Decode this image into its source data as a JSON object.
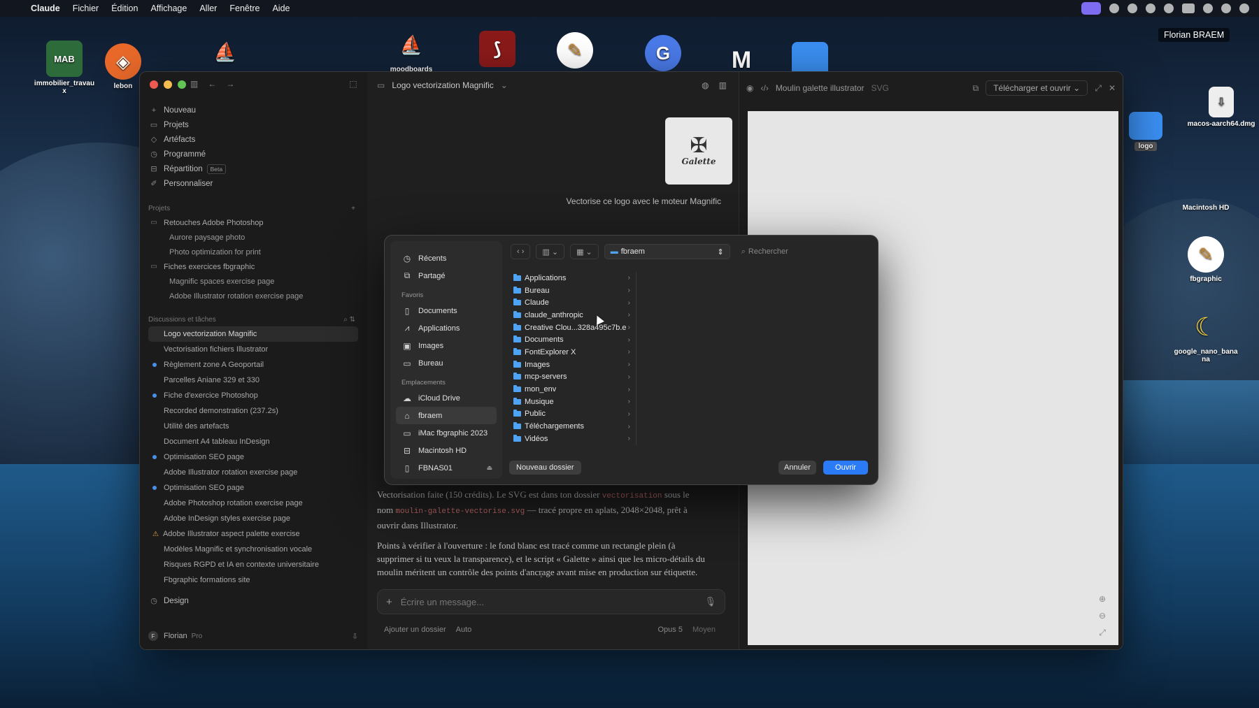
{
  "menubar": {
    "app": "Claude",
    "items": [
      "Fichier",
      "Édition",
      "Affichage",
      "Aller",
      "Fenêtre",
      "Aide"
    ]
  },
  "user_name": "Florian BRAEM",
  "desktop_icons": {
    "immobilier": "immobilier_travau\nx",
    "leboncoin": "lebon",
    "moodboards": "moodboards",
    "logo_folder": "logo",
    "dmg": "macos-aarch64.dmg",
    "macintosh": "Macintosh HD",
    "fbgraphic": "fbgraphic",
    "banana": "google_nano_bana na"
  },
  "sidebar": {
    "nav": [
      {
        "icon": "plus-icon",
        "label": "Nouveau"
      },
      {
        "icon": "folder-icon",
        "label": "Projets"
      },
      {
        "icon": "artifact-icon",
        "label": "Artéfacts"
      },
      {
        "icon": "clock-icon",
        "label": "Programmé"
      },
      {
        "icon": "split-icon",
        "label": "Répartition",
        "badge": "Beta"
      },
      {
        "icon": "brush-icon",
        "label": "Personnaliser"
      }
    ],
    "projects_title": "Projets",
    "projects": [
      {
        "label": "Retouches Adobe Photoshop",
        "level": 0
      },
      {
        "label": "Aurore paysage photo",
        "level": 1
      },
      {
        "label": "Photo optimization for print",
        "level": 1
      },
      {
        "label": "Fiches exercices fbgraphic",
        "level": 0
      },
      {
        "label": "Magnific spaces exercise page",
        "level": 1
      },
      {
        "label": "Adobe Illustrator rotation exercise page",
        "level": 1
      }
    ],
    "chats_title": "Discussions et tâches",
    "chats": [
      {
        "label": "Logo vectorization Magnific",
        "marker": "none",
        "active": true
      },
      {
        "label": "Vectorisation fichiers Illustrator",
        "marker": "none"
      },
      {
        "label": "Règlement zone A Geoportail",
        "marker": "blue"
      },
      {
        "label": "Parcelles Aniane 329 et 330",
        "marker": "none"
      },
      {
        "label": "Fiche d'exercice Photoshop",
        "marker": "blue"
      },
      {
        "label": "Recorded demonstration (237.2s)",
        "marker": "none"
      },
      {
        "label": "Utilité des artefacts",
        "marker": "none"
      },
      {
        "label": "Document A4 tableau InDesign",
        "marker": "none"
      },
      {
        "label": "Optimisation SEO page",
        "marker": "blue"
      },
      {
        "label": "Adobe Illustrator rotation exercise page",
        "marker": "none"
      },
      {
        "label": "Optimisation SEO page",
        "marker": "blue"
      },
      {
        "label": "Adobe Photoshop rotation exercise page",
        "marker": "none"
      },
      {
        "label": "Adobe InDesign styles exercise page",
        "marker": "none"
      },
      {
        "label": "Adobe Illustrator aspect palette exercise",
        "marker": "warn"
      },
      {
        "label": "Modèles Magnific et synchronisation vocale",
        "marker": "none"
      },
      {
        "label": "Risques RGPD et IA en contexte universitaire",
        "marker": "none"
      },
      {
        "label": "Fbgraphic formations site",
        "marker": "none"
      }
    ],
    "design": "Design",
    "footer": {
      "initial": "F",
      "name": "Florian",
      "plan": "Pro"
    }
  },
  "chat": {
    "title": "Logo vectorization Magnific",
    "thumb_text": "Galette",
    "user_message": "Vectorise ce logo avec le moteur Magnific",
    "p1_a": "Vectorisation faite (150 crédits). Le SVG est dans ton dossier ",
    "p1_code1": "vectorisation",
    "p1_b": " sous le nom ",
    "p1_code2": "moulin-galette-vectorise.svg",
    "p1_c": " — tracé propre en aplats, 2048×2048, prêt à ouvrir dans Illustrator.",
    "p2": "Points à vérifier à l'ouverture : le fond blanc est tracé comme un rectangle plein (à supprimer si tu veux la transparence), et le script « Galette » ainsi que les micro-détails du moulin méritent un contrôle des points d'ancrage avant mise en production sur étiquette.",
    "composer_placeholder": "Écrire un message...",
    "add_folder": "Ajouter un dossier",
    "auto": "Auto",
    "model": "Opus 5",
    "mode": "Moyen"
  },
  "artifact": {
    "title": "Moulin galette illustrator",
    "type": "SVG",
    "download": "Télécharger et ouvrir"
  },
  "dialog": {
    "sidebar_top": [
      {
        "icon": "clock-icon",
        "label": "Récents"
      },
      {
        "icon": "shared-icon",
        "label": "Partagé"
      }
    ],
    "favorites_title": "Favoris",
    "favorites": [
      {
        "icon": "document-icon",
        "label": "Documents"
      },
      {
        "icon": "applications-icon",
        "label": "Applications"
      },
      {
        "icon": "images-icon",
        "label": "Images"
      },
      {
        "icon": "desktop-icon",
        "label": "Bureau"
      }
    ],
    "locations_title": "Emplacements",
    "locations": [
      {
        "icon": "cloud-icon",
        "label": "iCloud Drive"
      },
      {
        "icon": "home-icon",
        "label": "fbraem",
        "active": true
      },
      {
        "icon": "computer-icon",
        "label": "iMac fbgraphic 2023"
      },
      {
        "icon": "disk-icon",
        "label": "Macintosh HD"
      },
      {
        "icon": "nas-icon",
        "label": "FBNAS01",
        "eject": true
      }
    ],
    "path": "fbraem",
    "search_placeholder": "Rechercher",
    "folders": [
      "Applications",
      "Bureau",
      "Claude",
      "claude_anthropic",
      "Creative Clou...328a495c7b.e",
      "Documents",
      "FontExplorer X",
      "Images",
      "mcp-servers",
      "mon_env",
      "Musique",
      "Public",
      "Téléchargements",
      "Vidéos"
    ],
    "new_folder": "Nouveau dossier",
    "cancel": "Annuler",
    "open": "Ouvrir"
  }
}
